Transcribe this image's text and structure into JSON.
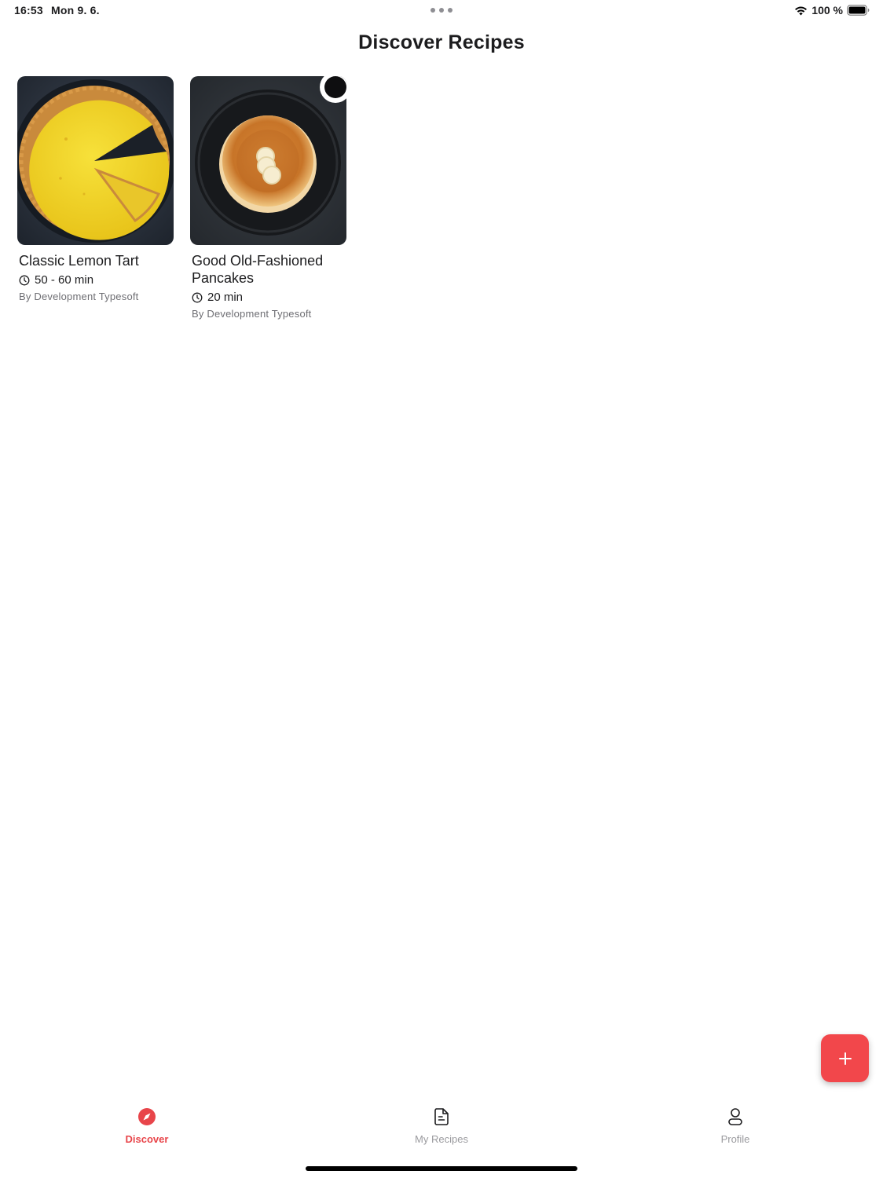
{
  "status_bar": {
    "time": "16:53",
    "date": "Mon 9. 6.",
    "battery_percent": "100 %",
    "battery_level": 1.0
  },
  "page": {
    "title": "Discover Recipes"
  },
  "recipes": [
    {
      "title": "Classic Lemon Tart",
      "time": "50 - 60 min",
      "author": "By Development Typesoft",
      "image": "lemon-tart-photo"
    },
    {
      "title": "Good Old-Fashioned Pancakes",
      "time": "20 min",
      "author": "By Development Typesoft",
      "image": "pancakes-photo"
    }
  ],
  "fab": {
    "icon": "plus-icon"
  },
  "tabs": [
    {
      "label": "Discover",
      "icon": "compass-icon",
      "active": true
    },
    {
      "label": "My Recipes",
      "icon": "document-icon",
      "active": false
    },
    {
      "label": "Profile",
      "icon": "person-icon",
      "active": false
    }
  ],
  "colors": {
    "accent": "#f2474b",
    "active_tab": "#e8454a",
    "inactive_tab": "#9a9a9e"
  }
}
